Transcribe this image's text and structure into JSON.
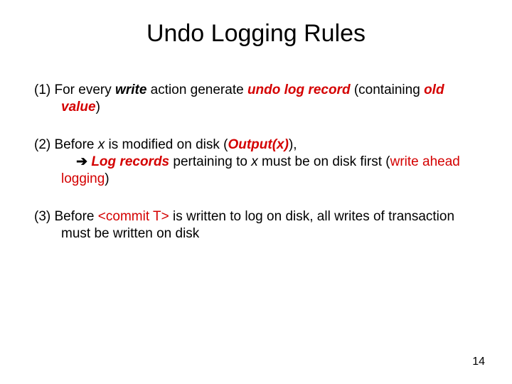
{
  "title": "Undo Logging Rules",
  "rule1": {
    "num": "(1)",
    "t1": " For every ",
    "write": "write",
    "t2": " action generate ",
    "undolog": "undo log record",
    "t3": " (containing ",
    "oldvalue": "old value",
    "t4": ")"
  },
  "rule2": {
    "num": "(2)",
    "t1": " Before ",
    "x1": "x",
    "t2": " is modified on disk (",
    "output": "Output(x)",
    "t3": "),",
    "arrow": "➔",
    "logrecords": " Log records",
    "t4": " pertaining to ",
    "x2": "x",
    "t5": " must be on disk first (",
    "wal": "write ahead logging",
    "t6": ")"
  },
  "rule3": {
    "num": "(3)",
    "t1": " Before ",
    "commit": "<commit T>",
    "t2": " is written to log on disk, all writes of transaction must be written on disk"
  },
  "page": "14"
}
